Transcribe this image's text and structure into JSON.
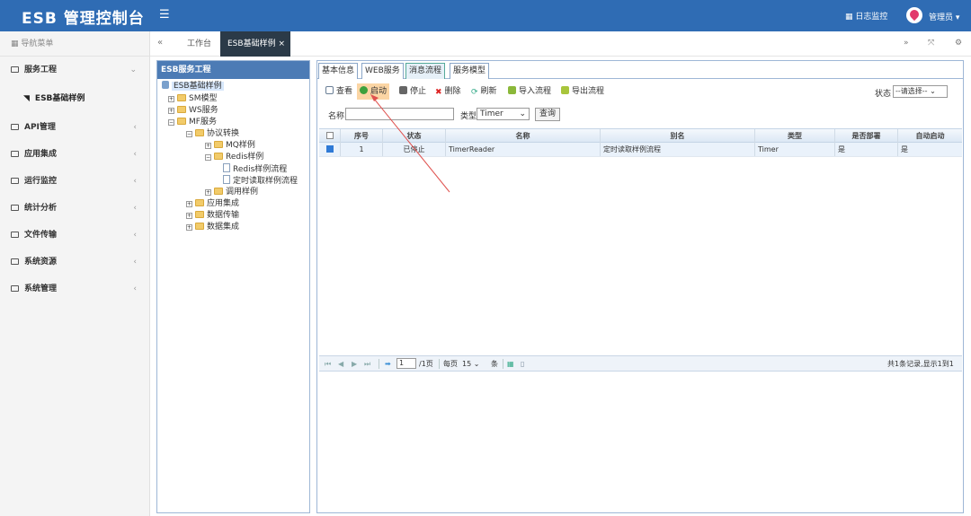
{
  "header": {
    "brand": "ESB 管理控制台",
    "menu_icon": "☰",
    "logs_label": "日志监控",
    "user_label": "管理员"
  },
  "tabs": {
    "items": [
      {
        "label": "工作台"
      },
      {
        "label": "ESB基础样例"
      }
    ],
    "close": "×"
  },
  "sidebar": {
    "heading": "导航菜单",
    "items": [
      {
        "label": "服务工程",
        "arrow": "⌄"
      },
      {
        "label": "API管理",
        "arrow": "‹"
      },
      {
        "label": "应用集成",
        "arrow": "‹"
      },
      {
        "label": "运行监控",
        "arrow": "‹"
      },
      {
        "label": "统计分析",
        "arrow": "‹"
      },
      {
        "label": "文件传输",
        "arrow": "‹"
      },
      {
        "label": "系统资源",
        "arrow": "‹"
      },
      {
        "label": "系统管理",
        "arrow": "‹"
      }
    ],
    "sub_item": "ESB基础样例"
  },
  "tree": {
    "title": "ESB服务工程",
    "nodes": [
      {
        "label": "ESB基础样例"
      },
      {
        "label": "SM模型"
      },
      {
        "label": "WS服务"
      },
      {
        "label": "MF服务"
      },
      {
        "label": "协议转换"
      },
      {
        "label": "MQ样例"
      },
      {
        "label": "Redis样例"
      },
      {
        "label": "Redis样例流程"
      },
      {
        "label": "定时读取样例流程"
      },
      {
        "label": "调用样例"
      },
      {
        "label": "应用集成"
      },
      {
        "label": "数据传输"
      },
      {
        "label": "数据集成"
      }
    ]
  },
  "main": {
    "tabs": [
      "基本信息",
      "WEB服务",
      "消息流程",
      "服务模型"
    ],
    "toolbar": [
      "查看",
      "启动",
      "停止",
      "删除",
      "刷新",
      "导入流程",
      "导出流程"
    ],
    "status_label": "状态",
    "status_value": "--请选择--",
    "filter": {
      "name_label": "名称",
      "name_value": "",
      "type_label": "类型",
      "type_value": "Timer",
      "query": "查询"
    },
    "columns": [
      "序号",
      "状态",
      "名称",
      "别名",
      "类型",
      "是否部署",
      "自动启动"
    ],
    "rows": [
      {
        "index": "1",
        "status": "已停止",
        "name": "TimerReader",
        "alias": "定时读取样例流程",
        "type": "Timer",
        "deployed": "是",
        "autostart": "是"
      }
    ],
    "pager": {
      "page": "1",
      "total_pages": "/1页",
      "per_page_label": "每页",
      "per_page": "15",
      "per_page_unit": "条",
      "summary": "共1条记录,显示1到1"
    }
  }
}
